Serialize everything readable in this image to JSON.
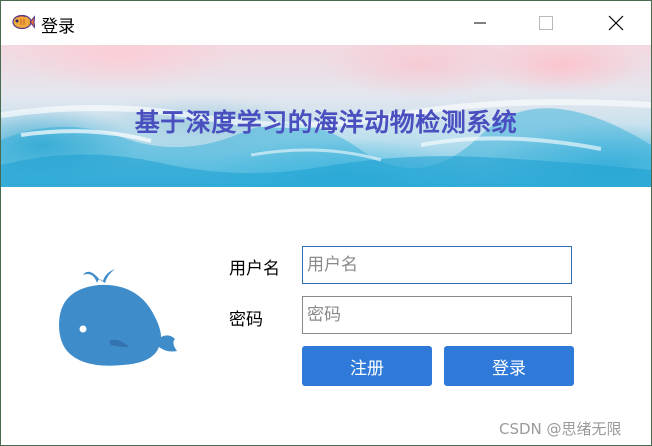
{
  "window": {
    "title": "登录",
    "controls": {
      "minimize": "minimize",
      "maximize": "maximize",
      "close": "close"
    }
  },
  "banner": {
    "title": "基于深度学习的海洋动物检测系统"
  },
  "form": {
    "username_label": "用户名",
    "username_placeholder": "用户名",
    "username_value": "",
    "password_label": "密码",
    "password_placeholder": "密码",
    "password_value": "",
    "register_label": "注册",
    "login_label": "登录"
  },
  "watermark": "CSDN @思绪无限",
  "colors": {
    "title_text": "#4a4fc0",
    "button_bg": "#2f7ad9",
    "whale": "#3f8ccb",
    "input_focus_border": "#2d6db9"
  },
  "icons": {
    "app": "fish-icon",
    "whale": "whale-icon"
  }
}
